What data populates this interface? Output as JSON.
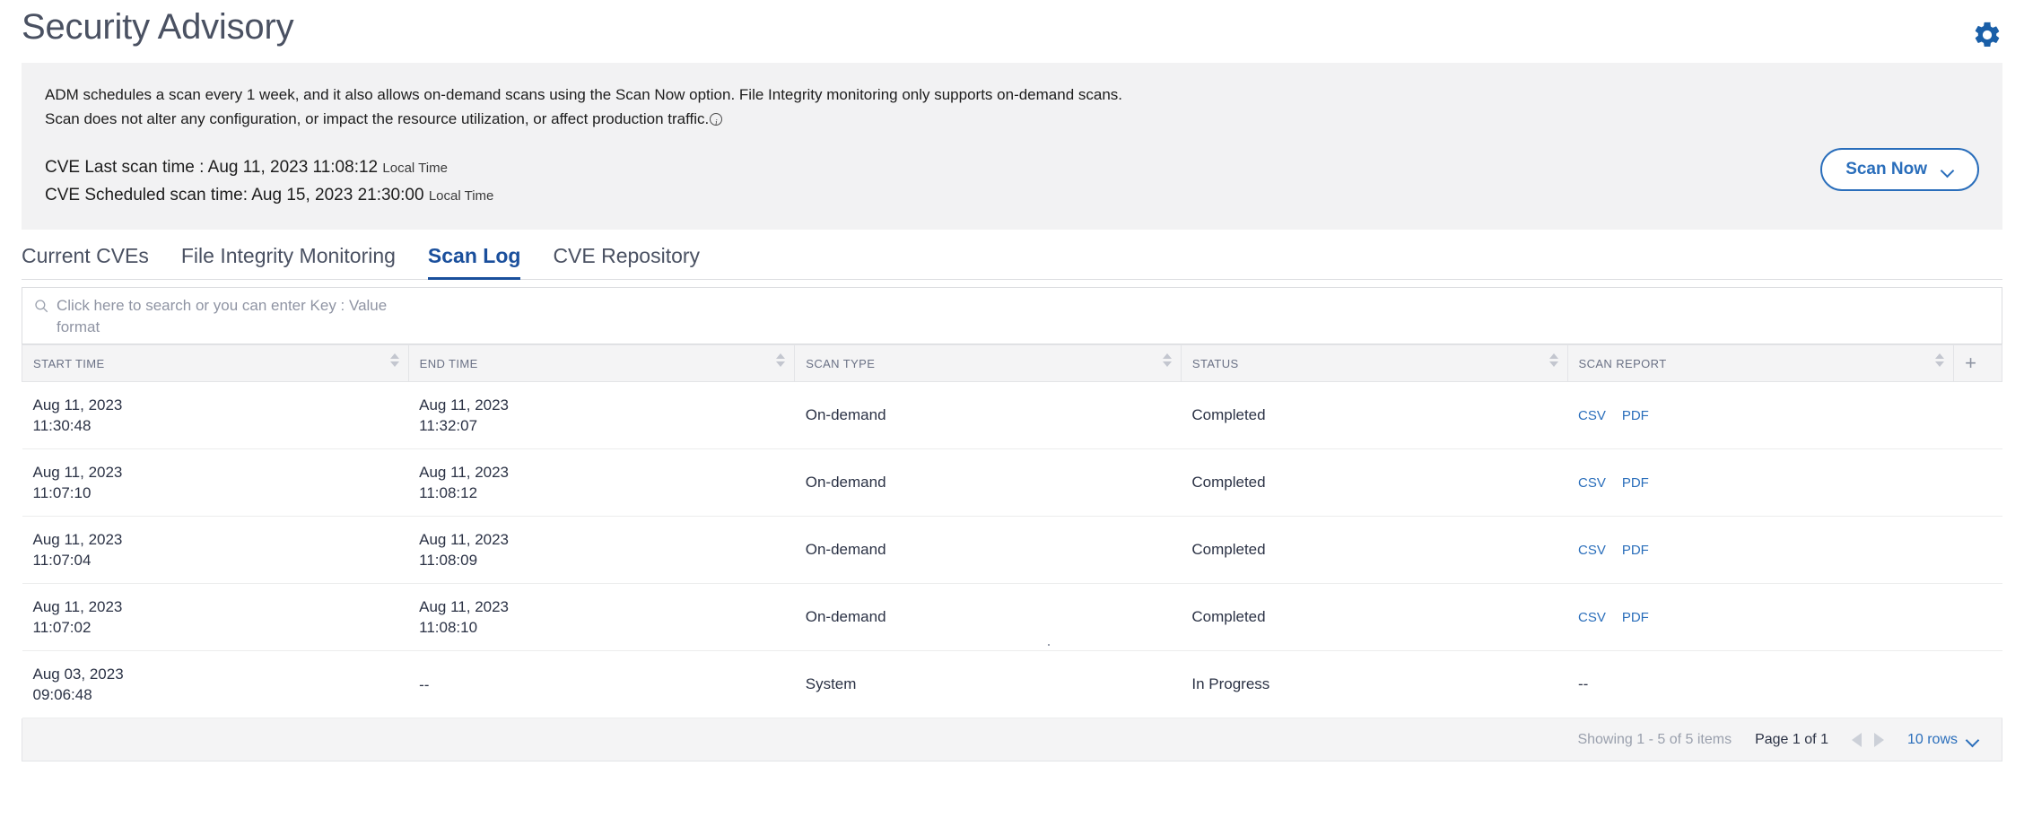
{
  "header": {
    "title": "Security Advisory",
    "settings_icon": "gear-icon"
  },
  "banner": {
    "line1": "ADM schedules a scan every 1 week, and it also allows on-demand scans using the Scan Now option. File Integrity monitoring only supports on-demand scans.",
    "line2": "Scan does not alter any configuration, or impact the resource utilization, or affect production traffic.",
    "info_icon": "info-circle-icon",
    "last_scan_label": "CVE Last scan time :",
    "last_scan_value": "Aug 11, 2023 11:08:12",
    "last_scan_tz": "Local Time",
    "scheduled_scan_label": "CVE Scheduled scan time:",
    "scheduled_scan_value": "Aug 15, 2023 21:30:00",
    "scheduled_scan_tz": "Local Time",
    "scan_now_label": "Scan Now",
    "scan_now_chevron": "chevron-down-icon"
  },
  "tabs": [
    {
      "label": "Current CVEs",
      "active": false
    },
    {
      "label": "File Integrity Monitoring",
      "active": false
    },
    {
      "label": "Scan Log",
      "active": true
    },
    {
      "label": "CVE Repository",
      "active": false
    }
  ],
  "search": {
    "icon": "search-icon",
    "placeholder": "Click here to search or you can enter Key : Value format",
    "value": ""
  },
  "table": {
    "columns": [
      {
        "label": "START TIME",
        "sortable": true
      },
      {
        "label": "END TIME",
        "sortable": true
      },
      {
        "label": "SCAN TYPE",
        "sortable": true
      },
      {
        "label": "STATUS",
        "sortable": true
      },
      {
        "label": "SCAN REPORT",
        "sortable": true
      }
    ],
    "add_column_icon": "plus-icon",
    "rows": [
      {
        "start_date": "Aug 11, 2023",
        "start_time": "11:30:48",
        "end_date": "Aug 11, 2023",
        "end_time": "11:32:07",
        "scan_type": "On-demand",
        "status": "Completed",
        "reports": [
          "CSV",
          "PDF"
        ]
      },
      {
        "start_date": "Aug 11, 2023",
        "start_time": "11:07:10",
        "end_date": "Aug 11, 2023",
        "end_time": "11:08:12",
        "scan_type": "On-demand",
        "status": "Completed",
        "reports": [
          "CSV",
          "PDF"
        ]
      },
      {
        "start_date": "Aug 11, 2023",
        "start_time": "11:07:04",
        "end_date": "Aug 11, 2023",
        "end_time": "11:08:09",
        "scan_type": "On-demand",
        "status": "Completed",
        "reports": [
          "CSV",
          "PDF"
        ]
      },
      {
        "start_date": "Aug 11, 2023",
        "start_time": "11:07:02",
        "end_date": "Aug 11, 2023",
        "end_time": "11:08:10",
        "scan_type": "On-demand",
        "status": "Completed",
        "reports": [
          "CSV",
          "PDF"
        ]
      },
      {
        "start_date": "Aug 03, 2023",
        "start_time": "09:06:48",
        "end_date": "--",
        "end_time": "",
        "scan_type": "System",
        "status": "In Progress",
        "reports": [
          "--"
        ]
      }
    ]
  },
  "footer": {
    "showing": "Showing 1 - 5 of 5 items",
    "page_label": "Page",
    "page_current": "1",
    "page_of": "of",
    "page_total": "1",
    "prev_icon": "chevron-left-icon",
    "next_icon": "chevron-right-icon",
    "rows_per_page": "10 rows",
    "rows_chevron": "chevron-down-icon"
  },
  "colors": {
    "accent": "#2a6ebb",
    "tab_active": "#1a4f9c",
    "title": "#4a5162",
    "banner_bg": "#f2f2f3"
  }
}
